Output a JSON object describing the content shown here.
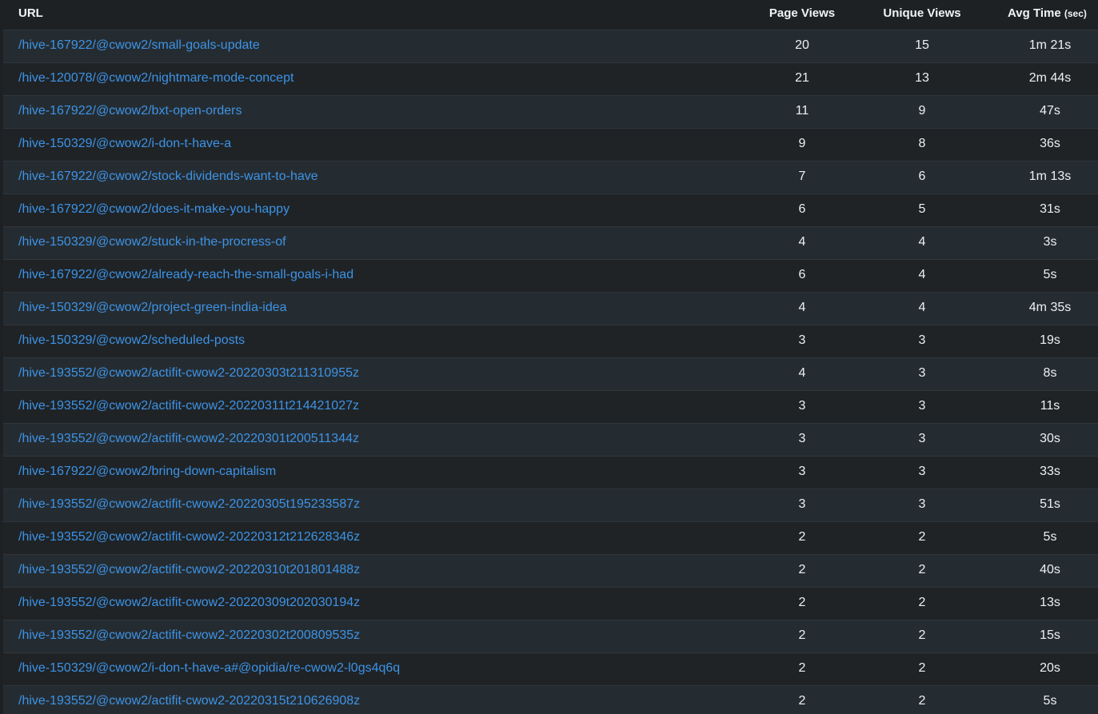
{
  "table": {
    "columns": {
      "url": "URL",
      "page_views": "Page Views",
      "unique_views": "Unique Views",
      "avg_time": "Avg Time",
      "avg_time_unit": "(sec)"
    },
    "rows": [
      {
        "url": "/hive-167922/@cwow2/small-goals-update",
        "page_views": "20",
        "unique_views": "15",
        "avg_time": "1m 21s"
      },
      {
        "url": "/hive-120078/@cwow2/nightmare-mode-concept",
        "page_views": "21",
        "unique_views": "13",
        "avg_time": "2m 44s"
      },
      {
        "url": "/hive-167922/@cwow2/bxt-open-orders",
        "page_views": "11",
        "unique_views": "9",
        "avg_time": "47s"
      },
      {
        "url": "/hive-150329/@cwow2/i-don-t-have-a",
        "page_views": "9",
        "unique_views": "8",
        "avg_time": "36s"
      },
      {
        "url": "/hive-167922/@cwow2/stock-dividends-want-to-have",
        "page_views": "7",
        "unique_views": "6",
        "avg_time": "1m 13s"
      },
      {
        "url": "/hive-167922/@cwow2/does-it-make-you-happy",
        "page_views": "6",
        "unique_views": "5",
        "avg_time": "31s"
      },
      {
        "url": "/hive-150329/@cwow2/stuck-in-the-procress-of",
        "page_views": "4",
        "unique_views": "4",
        "avg_time": "3s"
      },
      {
        "url": "/hive-167922/@cwow2/already-reach-the-small-goals-i-had",
        "page_views": "6",
        "unique_views": "4",
        "avg_time": "5s"
      },
      {
        "url": "/hive-150329/@cwow2/project-green-india-idea",
        "page_views": "4",
        "unique_views": "4",
        "avg_time": "4m 35s"
      },
      {
        "url": "/hive-150329/@cwow2/scheduled-posts",
        "page_views": "3",
        "unique_views": "3",
        "avg_time": "19s"
      },
      {
        "url": "/hive-193552/@cwow2/actifit-cwow2-20220303t211310955z",
        "page_views": "4",
        "unique_views": "3",
        "avg_time": "8s"
      },
      {
        "url": "/hive-193552/@cwow2/actifit-cwow2-20220311t214421027z",
        "page_views": "3",
        "unique_views": "3",
        "avg_time": "11s"
      },
      {
        "url": "/hive-193552/@cwow2/actifit-cwow2-20220301t200511344z",
        "page_views": "3",
        "unique_views": "3",
        "avg_time": "30s"
      },
      {
        "url": "/hive-167922/@cwow2/bring-down-capitalism",
        "page_views": "3",
        "unique_views": "3",
        "avg_time": "33s"
      },
      {
        "url": "/hive-193552/@cwow2/actifit-cwow2-20220305t195233587z",
        "page_views": "3",
        "unique_views": "3",
        "avg_time": "51s"
      },
      {
        "url": "/hive-193552/@cwow2/actifit-cwow2-20220312t212628346z",
        "page_views": "2",
        "unique_views": "2",
        "avg_time": "5s"
      },
      {
        "url": "/hive-193552/@cwow2/actifit-cwow2-20220310t201801488z",
        "page_views": "2",
        "unique_views": "2",
        "avg_time": "40s"
      },
      {
        "url": "/hive-193552/@cwow2/actifit-cwow2-20220309t202030194z",
        "page_views": "2",
        "unique_views": "2",
        "avg_time": "13s"
      },
      {
        "url": "/hive-193552/@cwow2/actifit-cwow2-20220302t200809535z",
        "page_views": "2",
        "unique_views": "2",
        "avg_time": "15s"
      },
      {
        "url": "/hive-150329/@cwow2/i-don-t-have-a#@opidia/re-cwow2-l0gs4q6q",
        "page_views": "2",
        "unique_views": "2",
        "avg_time": "20s"
      },
      {
        "url": "/hive-193552/@cwow2/actifit-cwow2-20220315t210626908z",
        "page_views": "2",
        "unique_views": "2",
        "avg_time": "5s"
      }
    ]
  },
  "colors": {
    "background": "#1e2124",
    "row_alt": "#252c31",
    "link": "#3d93e6",
    "text": "#eef0f2"
  }
}
